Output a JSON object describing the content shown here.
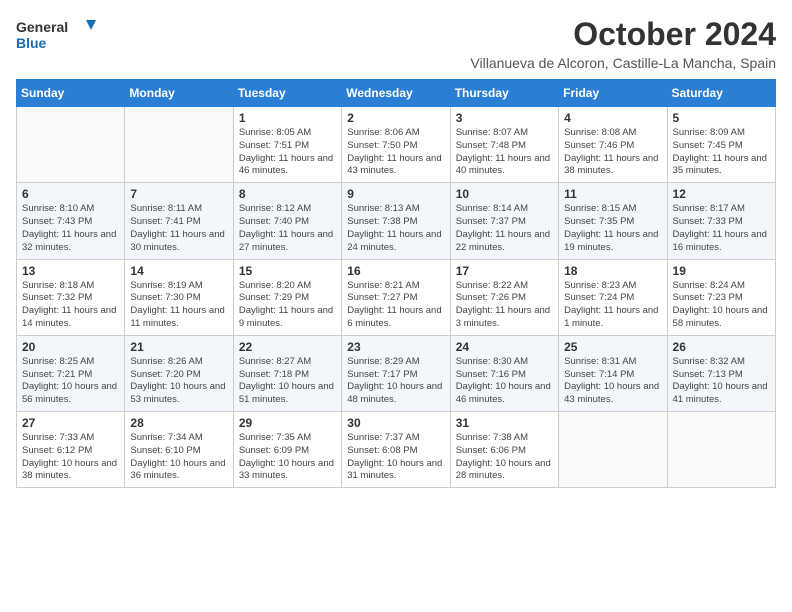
{
  "header": {
    "logo_line1": "General",
    "logo_line2": "Blue",
    "month": "October 2024",
    "location": "Villanueva de Alcoron, Castille-La Mancha, Spain"
  },
  "weekdays": [
    "Sunday",
    "Monday",
    "Tuesday",
    "Wednesday",
    "Thursday",
    "Friday",
    "Saturday"
  ],
  "weeks": [
    [
      {
        "day": "",
        "info": ""
      },
      {
        "day": "",
        "info": ""
      },
      {
        "day": "1",
        "info": "Sunrise: 8:05 AM\nSunset: 7:51 PM\nDaylight: 11 hours and 46 minutes."
      },
      {
        "day": "2",
        "info": "Sunrise: 8:06 AM\nSunset: 7:50 PM\nDaylight: 11 hours and 43 minutes."
      },
      {
        "day": "3",
        "info": "Sunrise: 8:07 AM\nSunset: 7:48 PM\nDaylight: 11 hours and 40 minutes."
      },
      {
        "day": "4",
        "info": "Sunrise: 8:08 AM\nSunset: 7:46 PM\nDaylight: 11 hours and 38 minutes."
      },
      {
        "day": "5",
        "info": "Sunrise: 8:09 AM\nSunset: 7:45 PM\nDaylight: 11 hours and 35 minutes."
      }
    ],
    [
      {
        "day": "6",
        "info": "Sunrise: 8:10 AM\nSunset: 7:43 PM\nDaylight: 11 hours and 32 minutes."
      },
      {
        "day": "7",
        "info": "Sunrise: 8:11 AM\nSunset: 7:41 PM\nDaylight: 11 hours and 30 minutes."
      },
      {
        "day": "8",
        "info": "Sunrise: 8:12 AM\nSunset: 7:40 PM\nDaylight: 11 hours and 27 minutes."
      },
      {
        "day": "9",
        "info": "Sunrise: 8:13 AM\nSunset: 7:38 PM\nDaylight: 11 hours and 24 minutes."
      },
      {
        "day": "10",
        "info": "Sunrise: 8:14 AM\nSunset: 7:37 PM\nDaylight: 11 hours and 22 minutes."
      },
      {
        "day": "11",
        "info": "Sunrise: 8:15 AM\nSunset: 7:35 PM\nDaylight: 11 hours and 19 minutes."
      },
      {
        "day": "12",
        "info": "Sunrise: 8:17 AM\nSunset: 7:33 PM\nDaylight: 11 hours and 16 minutes."
      }
    ],
    [
      {
        "day": "13",
        "info": "Sunrise: 8:18 AM\nSunset: 7:32 PM\nDaylight: 11 hours and 14 minutes."
      },
      {
        "day": "14",
        "info": "Sunrise: 8:19 AM\nSunset: 7:30 PM\nDaylight: 11 hours and 11 minutes."
      },
      {
        "day": "15",
        "info": "Sunrise: 8:20 AM\nSunset: 7:29 PM\nDaylight: 11 hours and 9 minutes."
      },
      {
        "day": "16",
        "info": "Sunrise: 8:21 AM\nSunset: 7:27 PM\nDaylight: 11 hours and 6 minutes."
      },
      {
        "day": "17",
        "info": "Sunrise: 8:22 AM\nSunset: 7:26 PM\nDaylight: 11 hours and 3 minutes."
      },
      {
        "day": "18",
        "info": "Sunrise: 8:23 AM\nSunset: 7:24 PM\nDaylight: 11 hours and 1 minute."
      },
      {
        "day": "19",
        "info": "Sunrise: 8:24 AM\nSunset: 7:23 PM\nDaylight: 10 hours and 58 minutes."
      }
    ],
    [
      {
        "day": "20",
        "info": "Sunrise: 8:25 AM\nSunset: 7:21 PM\nDaylight: 10 hours and 56 minutes."
      },
      {
        "day": "21",
        "info": "Sunrise: 8:26 AM\nSunset: 7:20 PM\nDaylight: 10 hours and 53 minutes."
      },
      {
        "day": "22",
        "info": "Sunrise: 8:27 AM\nSunset: 7:18 PM\nDaylight: 10 hours and 51 minutes."
      },
      {
        "day": "23",
        "info": "Sunrise: 8:29 AM\nSunset: 7:17 PM\nDaylight: 10 hours and 48 minutes."
      },
      {
        "day": "24",
        "info": "Sunrise: 8:30 AM\nSunset: 7:16 PM\nDaylight: 10 hours and 46 minutes."
      },
      {
        "day": "25",
        "info": "Sunrise: 8:31 AM\nSunset: 7:14 PM\nDaylight: 10 hours and 43 minutes."
      },
      {
        "day": "26",
        "info": "Sunrise: 8:32 AM\nSunset: 7:13 PM\nDaylight: 10 hours and 41 minutes."
      }
    ],
    [
      {
        "day": "27",
        "info": "Sunrise: 7:33 AM\nSunset: 6:12 PM\nDaylight: 10 hours and 38 minutes."
      },
      {
        "day": "28",
        "info": "Sunrise: 7:34 AM\nSunset: 6:10 PM\nDaylight: 10 hours and 36 minutes."
      },
      {
        "day": "29",
        "info": "Sunrise: 7:35 AM\nSunset: 6:09 PM\nDaylight: 10 hours and 33 minutes."
      },
      {
        "day": "30",
        "info": "Sunrise: 7:37 AM\nSunset: 6:08 PM\nDaylight: 10 hours and 31 minutes."
      },
      {
        "day": "31",
        "info": "Sunrise: 7:38 AM\nSunset: 6:06 PM\nDaylight: 10 hours and 28 minutes."
      },
      {
        "day": "",
        "info": ""
      },
      {
        "day": "",
        "info": ""
      }
    ]
  ]
}
